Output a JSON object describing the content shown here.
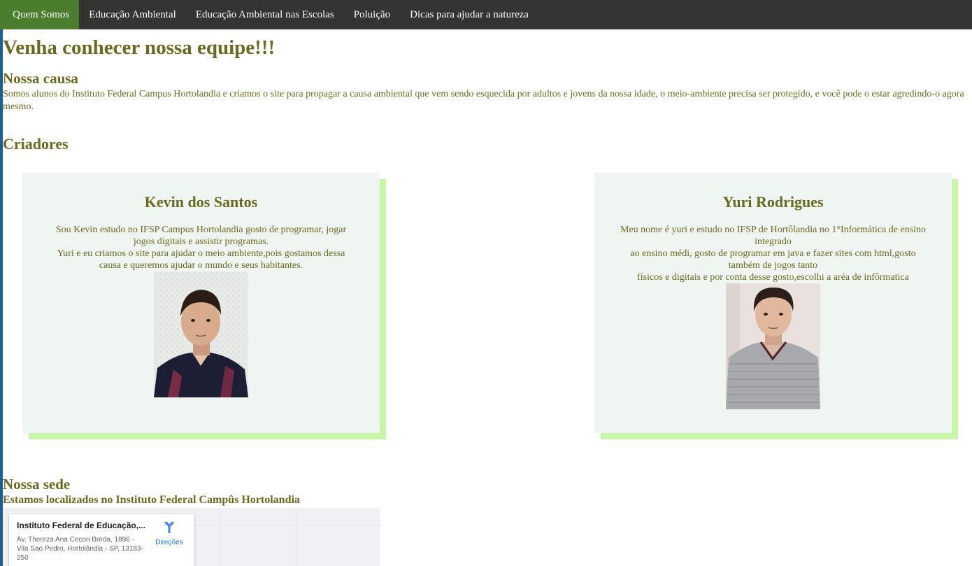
{
  "nav": {
    "items": [
      {
        "label": "Quem Somos",
        "active": true
      },
      {
        "label": "Educação Ambiental",
        "active": false
      },
      {
        "label": "Educação Ambiental nas Escolas",
        "active": false
      },
      {
        "label": "Poluição",
        "active": false
      },
      {
        "label": "Dicas para ajudar a natureza",
        "active": false
      }
    ],
    "background": "#333333",
    "active_background": "#4a7d2c"
  },
  "hero": {
    "title": "Venha conhecer nossa equipe!!!"
  },
  "cause": {
    "title": "Nossa causa",
    "text": "Somos alunos do Instituto Federal Campus Hortolandia e criamos o site para propagar a causa ambiental que vem sendo esquecida por adultos e jovens da nossa idade, o meio-ambiente precisa ser protegido, e você pode o estar agredindo-o agora mesmo."
  },
  "creators": {
    "title": "Criadores",
    "cards": [
      {
        "name": "Kevin dos Santos",
        "bio_lines": [
          "Sou Kevin estudo no IFSP Campus Hortolandia gosto de programar, jogar jogos digitais e assistir programas.",
          "Yuri e eu criamos o site para ajudar o meio ambiente,pois gostamos dessa causa e queremos ajudar o mundo e seus habitantes."
        ]
      },
      {
        "name": "Yuri Rodrigues",
        "bio_lines": [
          "Meu nome é yuri e estudo no IFSP de Hortôlandia no 1°Informática de ensino integrado",
          "ao ensino médi, gosto de programar em java e fazer sites com html,gosto também de jogos tanto",
          "físicos e digitais e por conta desse gosto,escolhi a aréa de infôrmatica"
        ]
      }
    ],
    "card_background": "#eff5f0",
    "card_shadow": "#c8f5a8"
  },
  "sede": {
    "title": "Nossa sede",
    "subtitle": "Estamos localizados no Instituto Federal Campûs Hortolandia",
    "map": {
      "place_name": "Instituto Federal de Educação,...",
      "address": "Av. Thereza Ana Cecon Breda, 1896 - Vila Sao Pedro, Hortolândia - SP, 13183-250",
      "directions_label": "Direções"
    }
  },
  "colors": {
    "text": "#6b6a22",
    "link_blue": "#1a73e8"
  }
}
